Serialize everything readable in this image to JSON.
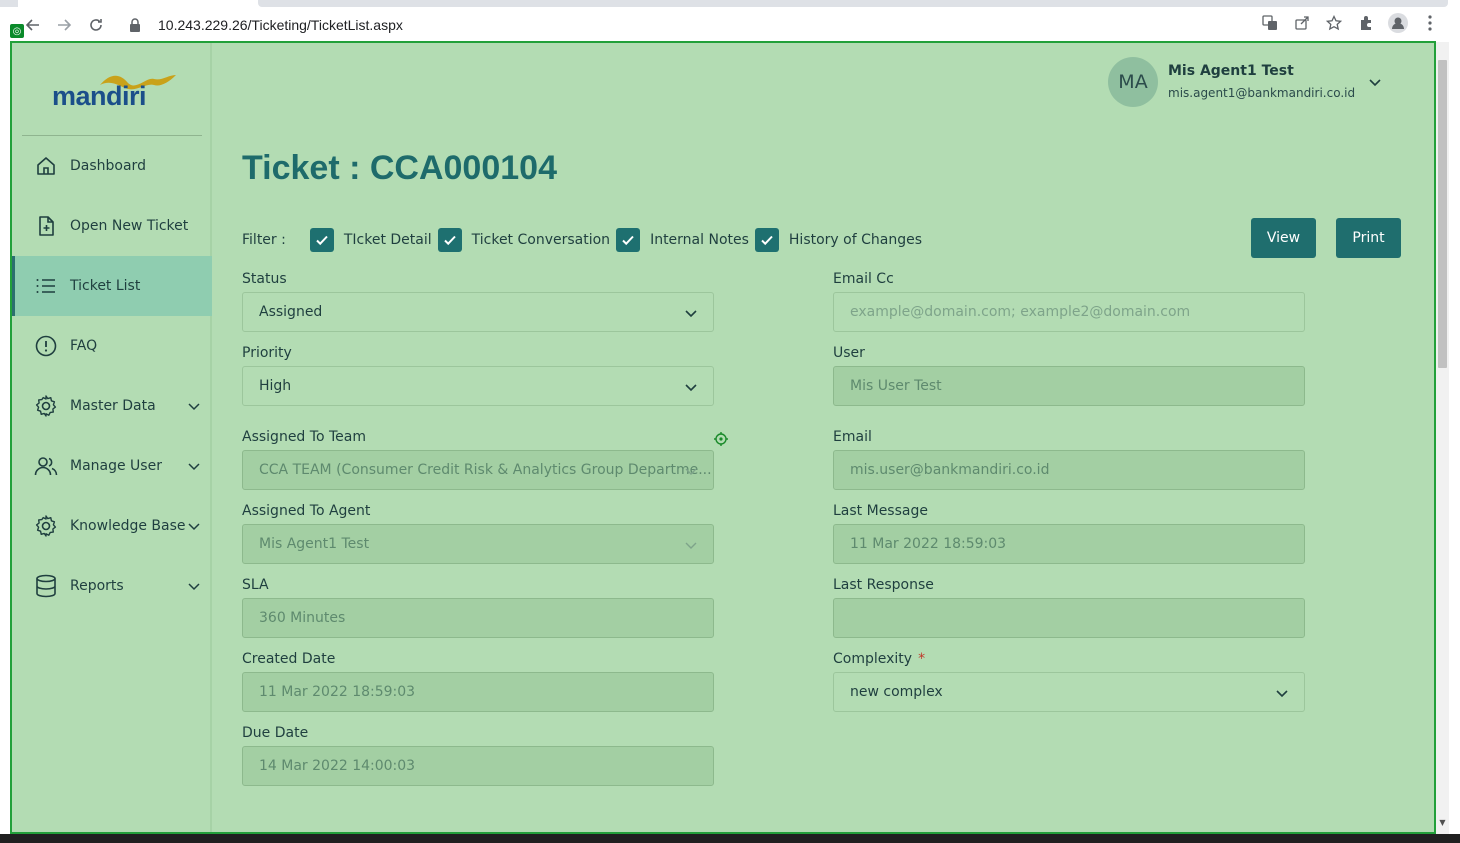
{
  "browser": {
    "url": "10.243.229.26/Ticketing/TicketList.aspx"
  },
  "app": {
    "logo_text": "mandiri",
    "logo_wave_color": "#c9a21a",
    "accent_color": "#1f6e6e",
    "sidebar": {
      "items": [
        {
          "label": "Dashboard",
          "icon": "home-icon",
          "active": false,
          "expandable": false
        },
        {
          "label": "Open New Ticket",
          "icon": "file-plus-icon",
          "active": false,
          "expandable": false
        },
        {
          "label": "Ticket List",
          "icon": "list-icon",
          "active": true,
          "expandable": false
        },
        {
          "label": "FAQ",
          "icon": "alert-circle-icon",
          "active": false,
          "expandable": false
        },
        {
          "label": "Master Data",
          "icon": "gear-icon",
          "active": false,
          "expandable": true
        },
        {
          "label": "Manage User",
          "icon": "users-icon",
          "active": false,
          "expandable": true
        },
        {
          "label": "Knowledge Base",
          "icon": "gear-icon",
          "active": false,
          "expandable": true
        },
        {
          "label": "Reports",
          "icon": "database-icon",
          "active": false,
          "expandable": true
        }
      ]
    },
    "user": {
      "initials": "MA",
      "name": "Mis Agent1 Test",
      "email": "mis.agent1@bankmandiri.co.id"
    }
  },
  "ticket": {
    "title": "Ticket : CCA000104",
    "filter": {
      "label": "Filter :",
      "options": [
        {
          "label": "TIcket Detail",
          "checked": true
        },
        {
          "label": "Ticket Conversation",
          "checked": true
        },
        {
          "label": "Internal Notes",
          "checked": true
        },
        {
          "label": "History of Changes",
          "checked": true
        }
      ]
    },
    "buttons": {
      "view": "View",
      "print": "Print"
    },
    "left_fields": {
      "status": {
        "label": "Status",
        "value": "Assigned"
      },
      "priority": {
        "label": "Priority",
        "value": "High"
      },
      "assigned_team": {
        "label": "Assigned To Team",
        "value": "CCA TEAM (Consumer Credit Risk & Analytics Group Departme..."
      },
      "assigned_agent": {
        "label": "Assigned To Agent",
        "value": "Mis Agent1 Test"
      },
      "sla": {
        "label": "SLA",
        "value": "360 Minutes"
      },
      "created_date": {
        "label": "Created Date",
        "value": "11 Mar 2022 18:59:03"
      },
      "due_date": {
        "label": "Due Date",
        "value": "14 Mar 2022 14:00:03"
      }
    },
    "right_fields": {
      "email_cc": {
        "label": "Email Cc",
        "value": "",
        "placeholder": "example@domain.com; example2@domain.com"
      },
      "user": {
        "label": "User",
        "value": "Mis User Test"
      },
      "email": {
        "label": "Email",
        "value": "mis.user@bankmandiri.co.id"
      },
      "last_message": {
        "label": "Last Message",
        "value": "11 Mar 2022 18:59:03"
      },
      "last_response": {
        "label": "Last Response",
        "value": ""
      },
      "complexity": {
        "label": "Complexity",
        "required_mark": "*",
        "value": "new complex"
      }
    }
  }
}
